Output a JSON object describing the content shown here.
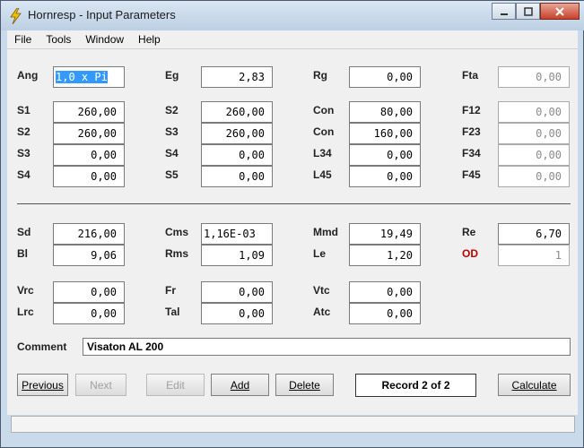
{
  "window": {
    "title": "Hornresp - Input Parameters",
    "app_icon": "lightning-icon"
  },
  "menu": [
    "File",
    "Tools",
    "Window",
    "Help"
  ],
  "params": {
    "Ang": {
      "label": "Ang",
      "value": "1,0 x Pi"
    },
    "Eg": {
      "label": "Eg",
      "value": "2,83"
    },
    "Rg": {
      "label": "Rg",
      "value": "0,00"
    },
    "Fta": {
      "label": "Fta",
      "value": "0,00"
    },
    "S1": {
      "label": "S1",
      "value": "260,00"
    },
    "S2a": {
      "label": "S2",
      "value": "260,00"
    },
    "Con1": {
      "label": "Con",
      "value": "80,00"
    },
    "F12": {
      "label": "F12",
      "value": "0,00"
    },
    "S2b": {
      "label": "S2",
      "value": "260,00"
    },
    "S3a": {
      "label": "S3",
      "value": "260,00"
    },
    "Con2": {
      "label": "Con",
      "value": "160,00"
    },
    "F23": {
      "label": "F23",
      "value": "0,00"
    },
    "S3b": {
      "label": "S3",
      "value": "0,00"
    },
    "S4a": {
      "label": "S4",
      "value": "0,00"
    },
    "L34": {
      "label": "L34",
      "value": "0,00"
    },
    "F34": {
      "label": "F34",
      "value": "0,00"
    },
    "S4b": {
      "label": "S4",
      "value": "0,00"
    },
    "S5": {
      "label": "S5",
      "value": "0,00"
    },
    "L45": {
      "label": "L45",
      "value": "0,00"
    },
    "F45": {
      "label": "F45",
      "value": "0,00"
    },
    "Sd": {
      "label": "Sd",
      "value": "216,00"
    },
    "Cms": {
      "label": "Cms",
      "value": "1,16E-03"
    },
    "Mmd": {
      "label": "Mmd",
      "value": "19,49"
    },
    "Re": {
      "label": "Re",
      "value": "6,70"
    },
    "Bl": {
      "label": "Bl",
      "value": "9,06"
    },
    "Rms": {
      "label": "Rms",
      "value": "1,09"
    },
    "Le": {
      "label": "Le",
      "value": "1,20"
    },
    "OD": {
      "label": "OD",
      "value": "1"
    },
    "Vrc": {
      "label": "Vrc",
      "value": "0,00"
    },
    "Fr": {
      "label": "Fr",
      "value": "0,00"
    },
    "Vtc": {
      "label": "Vtc",
      "value": "0,00"
    },
    "Lrc": {
      "label": "Lrc",
      "value": "0,00"
    },
    "Tal": {
      "label": "Tal",
      "value": "0,00"
    },
    "Atc": {
      "label": "Atc",
      "value": "0,00"
    }
  },
  "comment": {
    "label": "Comment",
    "value": "Visaton AL 200"
  },
  "buttons": {
    "previous": "Previous",
    "next": "Next",
    "edit": "Edit",
    "add": "Add",
    "delete": "Delete",
    "calculate": "Calculate"
  },
  "record": "Record 2 of 2"
}
